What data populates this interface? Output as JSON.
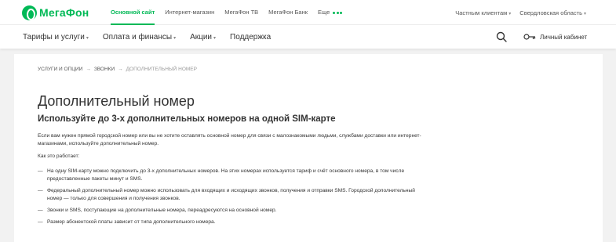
{
  "brand": {
    "logo_text": "МегаФон",
    "accent": "#00b956"
  },
  "topbar": {
    "links": [
      "Основной сайт",
      "Интернет-магазин",
      "МегаФон ТВ",
      "МегаФон Банк",
      "Еще"
    ],
    "client_type": "Частным клиентам",
    "region": "Свердловская область"
  },
  "mainnav": {
    "items": [
      "Тарифы и услуги",
      "Оплата и финансы",
      "Акции",
      "Поддержка"
    ],
    "account_label": "Личный кабинет"
  },
  "breadcrumb": {
    "items": [
      "Услуги и опции",
      "Звонки",
      "Дополнительный номер"
    ],
    "separator": "→"
  },
  "page": {
    "title": "Дополнительный номер",
    "subtitle": "Используйте до 3-х дополнительных номеров на одной SIM-карте",
    "intro": "Если вам нужен прямой городской номер или вы не хотите оставлять основной номер для связи с малознакомыми людьми, службами доставки или интернет-магазинами, используйте дополнительный номер.",
    "how_label": "Как это работает:",
    "bullets": [
      "На одну SIM-карту можно подключить до 3-х дополнительных номеров. На этих номерах используется тариф и счёт основного номера, в том числе предоставленные пакеты минут и SMS.",
      "Федеральный дополнительный номер можно использовать для входящих и исходящих звонков, получения и отправки SMS. Городской дополнительный номер — только для совершения и получения звонков.",
      "Звонки и SMS, поступающие на дополнительные номера, переадресуются на основной номер.",
      "Размер абонентской платы зависит от типа дополнительного номера."
    ]
  }
}
